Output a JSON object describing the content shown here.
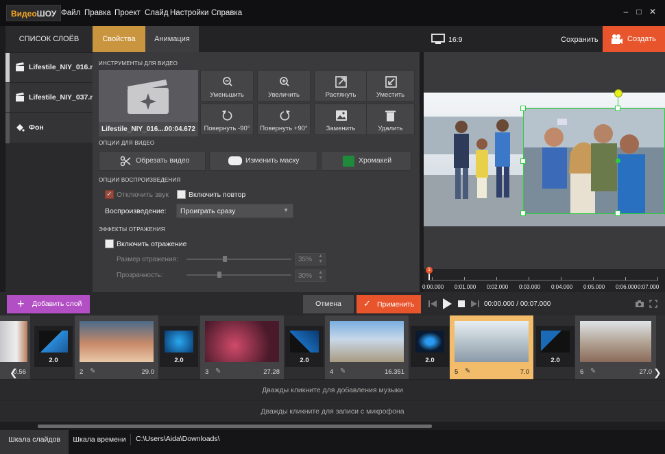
{
  "app": {
    "logo_a": "Видео",
    "logo_b": "ШОУ"
  },
  "menu": [
    "Файл",
    "Правка",
    "Проект",
    "Слайд",
    "Настройки",
    "Справка"
  ],
  "layers": {
    "title": "СПИСОК СЛОЁВ",
    "items": [
      "Lifestile_NIY_016.m...",
      "Lifestile_NIY_037.m...",
      "Фон"
    ]
  },
  "tabs": {
    "props": "Свойства",
    "anim": "Анимация"
  },
  "tools": {
    "section": "ИНСТРУМЕНТЫ ДЛЯ ВИДЕО",
    "clip_name": "Lifestile_NIY_016....",
    "clip_dur": "00:04.672",
    "buttons": [
      "Уменьшить",
      "Увеличить",
      "Растянуть",
      "Уместить",
      "Повернуть -90°",
      "Повернуть +90°",
      "Заменить",
      "Удалить"
    ]
  },
  "options": {
    "section": "ОПЦИИ ДЛЯ ВИДЕО",
    "crop": "Обрезать видео",
    "mask": "Изменить маску",
    "chroma": "Хромакей"
  },
  "playback": {
    "section": "ОПЦИИ ВОСПРОИЗВЕДЕНИЯ",
    "mute": "Отключить звук",
    "mute_checked": true,
    "loop": "Включить повтор",
    "loop_checked": false,
    "label": "Воспроизведение:",
    "value": "Проиграть сразу"
  },
  "reflection": {
    "section": "ЭФФЕКТЫ ОТРАЖЕНИЯ",
    "enable": "Включить отражение",
    "enable_checked": false,
    "size_label": "Размер отражения:",
    "size_value": "35%",
    "size_level": 0.35,
    "opacity_label": "Прозрачность:",
    "opacity_value": "30%",
    "opacity_level": 0.3
  },
  "preview": {
    "ratio": "16:9",
    "save": "Сохранить",
    "create": "Создать",
    "ruler_marker": "1",
    "ticks": [
      "0:00.000",
      "0:01.000",
      "0:02.000",
      "0:03.000",
      "0:04.000",
      "0:05.000",
      "0:06.000",
      "0:07.000"
    ]
  },
  "toolbar": {
    "add_layer": "Добавить слой",
    "cancel": "Отмена",
    "apply": "Применить",
    "time_current": "00:00.000",
    "time_sep": " / ",
    "time_total": "00:07.000"
  },
  "slides": [
    {
      "num": "",
      "dur": "0.56"
    },
    {
      "num": "2",
      "dur": "29.0"
    },
    {
      "num": "3",
      "dur": "27.28"
    },
    {
      "num": "4",
      "dur": "16.351"
    },
    {
      "num": "5",
      "dur": "7.0"
    },
    {
      "num": "6",
      "dur": "27.0"
    }
  ],
  "transitions": [
    "2.0",
    "2.0",
    "2.0",
    "2.0",
    "2.0"
  ],
  "tracks": {
    "music": "Дважды кликните для добавления музыки",
    "mic": "Дважды кликните для записи с микрофона"
  },
  "bottom": {
    "slides_tab": "Шкала слайдов",
    "timeline_tab": "Шкала времени",
    "path": "C:\\Users\\Aida\\Downloads\\"
  },
  "colors": {
    "accent": "#e8542c",
    "tab_active": "#c9953f",
    "add_layer": "#b24fc4",
    "selected_slide": "#f2bc6a",
    "chroma": "#1f8a3a"
  }
}
